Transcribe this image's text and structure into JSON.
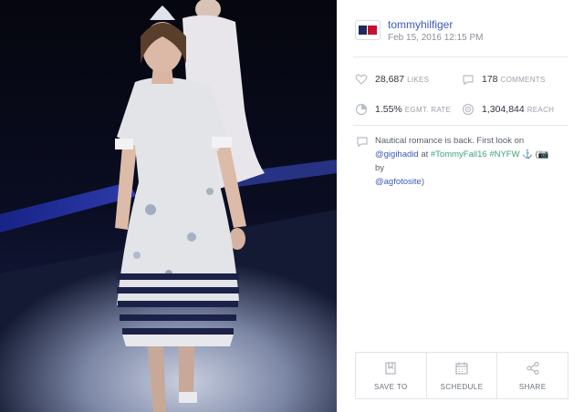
{
  "post": {
    "username": "tommyhilfiger",
    "date": "Feb 15, 2016 12:15 PM",
    "avatar_icon": "tommy-hilfiger-flag-logo"
  },
  "stats": {
    "likes_value": "28,687",
    "likes_label": "LIKES",
    "comments_value": "178",
    "comments_label": "COMMENTS",
    "engagement_value": "1.55%",
    "engagement_label": "EGMT. RATE",
    "reach_value": "1,304,844",
    "reach_label": "REACH"
  },
  "caption": {
    "text_1": "Nautical romance is back. First look on",
    "mention_1": "@gigihadid",
    "text_2": " at ",
    "hashtag_1": "#TommyFall16",
    "text_3": " ",
    "hashtag_2": "#NYFW",
    "text_4": " ⚓ (📷 by",
    "mention_2": "@agfotosite",
    "text_5": ")"
  },
  "actions": {
    "save_label": "SAVE TO",
    "schedule_label": "SCHEDULE",
    "share_label": "SHARE"
  },
  "colors": {
    "link": "#3b5bb8",
    "hashtag": "#3aa37a",
    "muted": "#9aa0a8"
  }
}
